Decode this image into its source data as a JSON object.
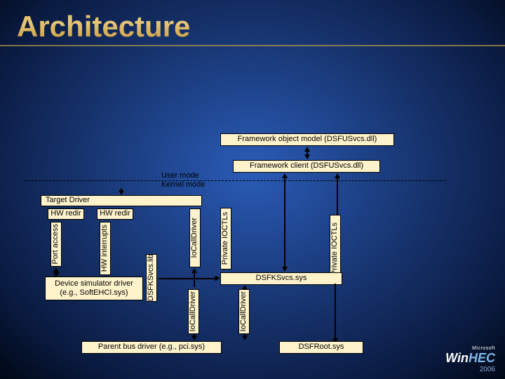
{
  "title": "Architecture",
  "boxes": {
    "framework_object_model": "Framework object model (DSFUSvcs.dll)",
    "framework_client": "Framework client (DSFUSvcs.dll)",
    "target_driver": "Target Driver",
    "hw_redir_1": "HW redir",
    "hw_redir_2": "HW redir",
    "port_access": "Port access",
    "hw_interrupts": "HW interrupts",
    "dsfksvcs_lib": "DSFKSvcs.lib",
    "device_simulator_driver": "Device simulator driver (e.g., SoftEHCI.sys)",
    "dsfksvcs_sys": "DSFKSvcs.sys",
    "parent_bus_driver": "Parent bus driver (e.g., pci.sys)",
    "dsfroot_sys": "DSFRoot.sys",
    "iocalldriver": "IoCallDriver",
    "private_ioctls": "Private IOCTLs"
  },
  "labels": {
    "user_mode": "User mode",
    "kernel_mode": "Kernel mode"
  },
  "logo": {
    "ms": "Microsoft",
    "win": "Win",
    "hec": "HEC",
    "year": "2006"
  }
}
